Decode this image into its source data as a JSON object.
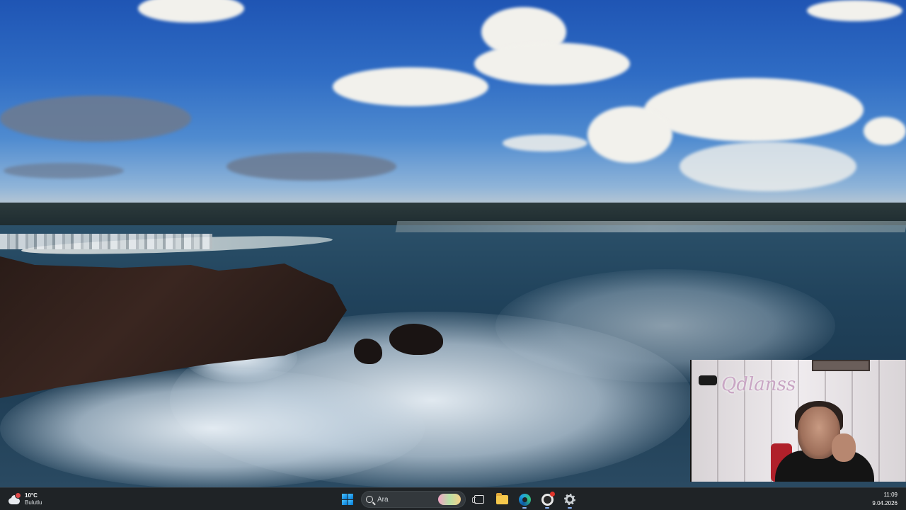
{
  "taskbar": {
    "weather": {
      "temperature": "10°C",
      "condition": "Bulutlu"
    },
    "search": {
      "placeholder": "Ara"
    },
    "apps": [
      "start",
      "search",
      "task-view",
      "file-explorer",
      "edge",
      "obs-studio",
      "settings"
    ],
    "clock": {
      "time": "11:09",
      "date": "9.04.2026"
    }
  },
  "webcam": {
    "neon_sign": "Qdlanss"
  },
  "colors": {
    "taskbar_bg": "#1f2326",
    "accent": "#0078d4"
  }
}
